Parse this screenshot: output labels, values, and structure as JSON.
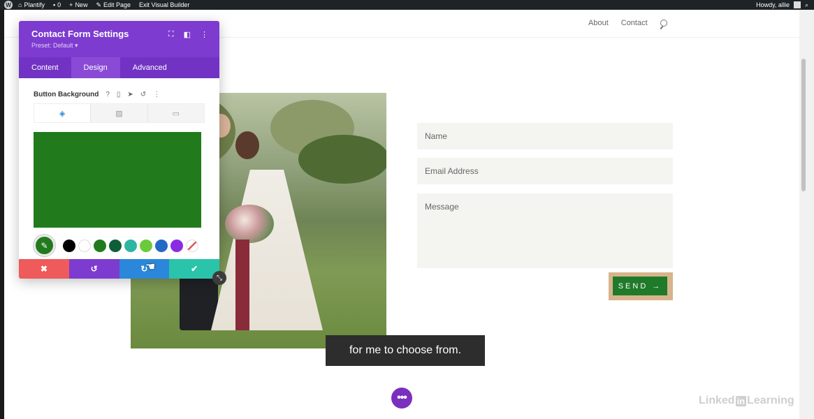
{
  "adminbar": {
    "site": "Plantify",
    "comments": "0",
    "new": "New",
    "edit_page": "Edit Page",
    "exit_vb": "Exit Visual Builder",
    "howdy": "Howdy, allie"
  },
  "nav": {
    "about": "About",
    "contact": "Contact"
  },
  "form": {
    "name": "Name",
    "email": "Email Address",
    "message": "Message",
    "send": "SEND",
    "send_arrow": "→"
  },
  "subtitle": "for me to choose from.",
  "watermark": {
    "pre": "Linked",
    "in": "in",
    "post": "Learning"
  },
  "panel": {
    "title": "Contact Form Settings",
    "preset": "Preset: Default ▾",
    "tabs": [
      "Content",
      "Design",
      "Advanced"
    ],
    "active_tab": "Design",
    "option_label": "Button Background",
    "preview_color": "#217b1c",
    "swatches": [
      "#000000",
      "#ffffff",
      "#217b1c",
      "#0f5e3a",
      "#2fb5a3",
      "#6acb3a",
      "#2569c4",
      "#8a2be2"
    ]
  },
  "fab_label": "•••"
}
